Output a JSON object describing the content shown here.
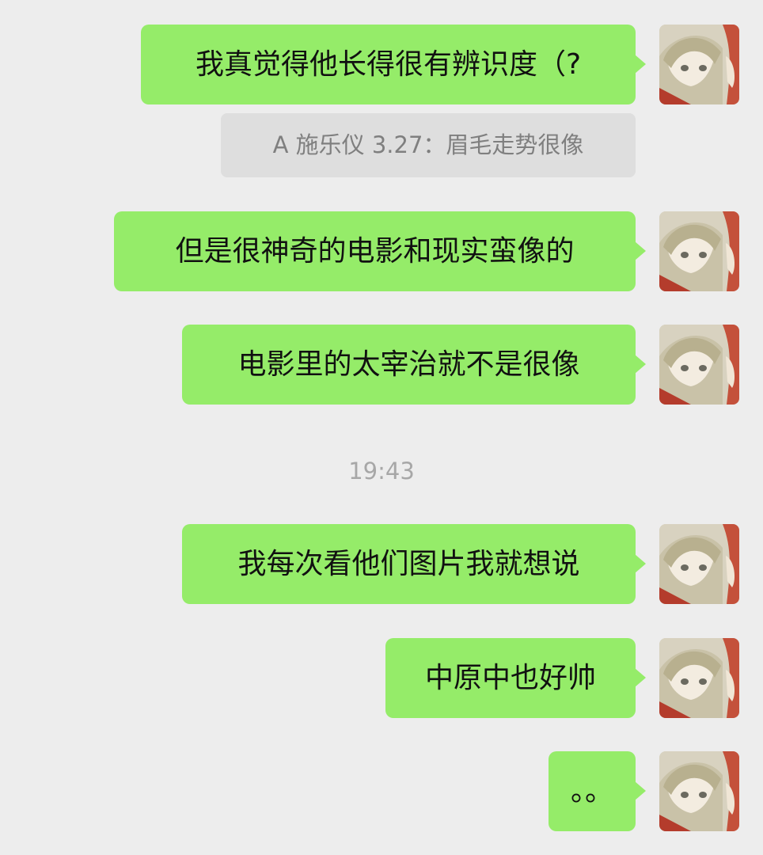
{
  "messages": [
    {
      "text": "我真觉得他长得很有辨识度（?",
      "avatar_icon": "anime-avatar-icon"
    },
    {
      "text": "但是很神奇的电影和现实蛮像的",
      "avatar_icon": "anime-avatar-icon"
    },
    {
      "text": "电影里的太宰治就不是很像",
      "avatar_icon": "anime-avatar-icon"
    },
    {
      "text": "我每次看他们图片我就想说",
      "avatar_icon": "anime-avatar-icon"
    },
    {
      "text": "中原中也好帅",
      "avatar_icon": "anime-avatar-icon"
    },
    {
      "text": "。。",
      "avatar_icon": "anime-avatar-icon"
    }
  ],
  "quote": {
    "text": "A 施乐仪 3.27：眉毛走势很像"
  },
  "timestamp": "19:43",
  "colors": {
    "background": "#ededed",
    "bubble": "#95ec69",
    "quote_bg": "#dedede"
  }
}
